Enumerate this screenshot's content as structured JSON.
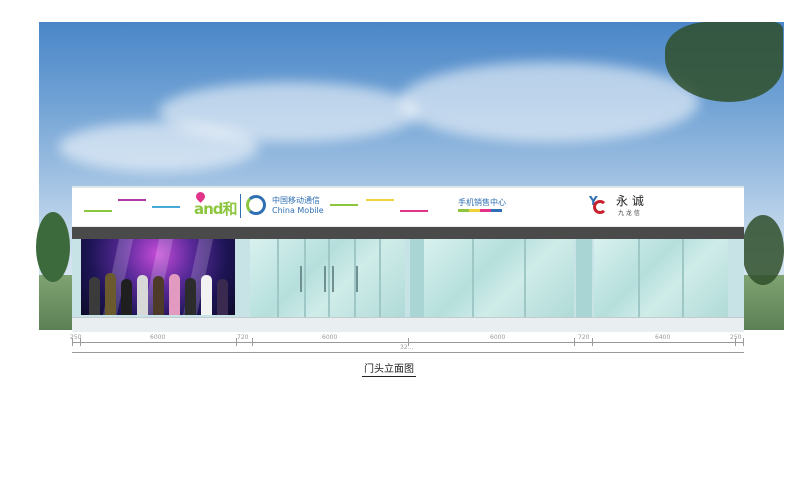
{
  "fascia": {
    "andhe_logo": "and和",
    "cmcc_cn": "中国移动通信",
    "cmcc_en": "China Mobile",
    "shop_name": "手机销售中心",
    "yongcheng_big": "永 诚",
    "yongcheng_small": "九 龙 信"
  },
  "dimensions": {
    "segments": [
      "250",
      "6000",
      "720",
      "6000",
      "6000",
      "720",
      "6400",
      "250"
    ],
    "total": "32..."
  },
  "caption": "门头立面图",
  "colors": {
    "fascia": "#ffffff",
    "band": "#4a4a4a",
    "glass": "#c7e3e6",
    "andhe_pink": "#e2338a",
    "andhe_green": "#8cc63e",
    "cmcc_blue": "#2f6fb3",
    "yongcheng_red": "#c8202c"
  }
}
